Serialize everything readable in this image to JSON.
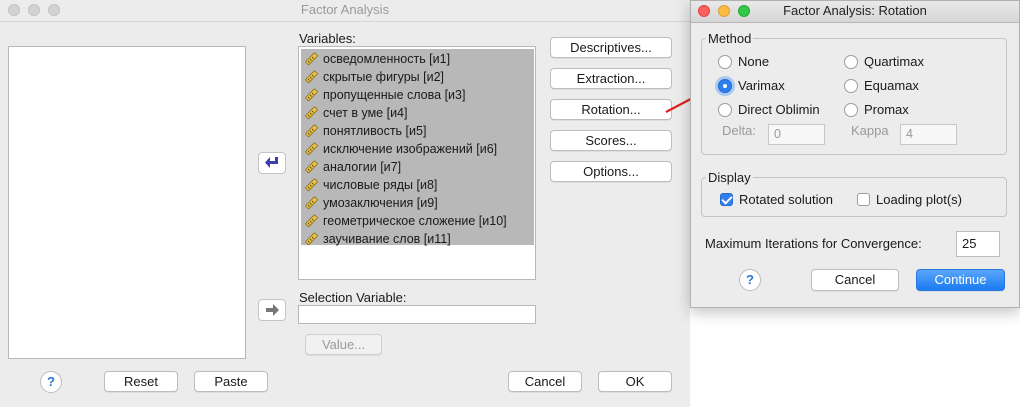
{
  "main_dialog": {
    "title": "Factor Analysis",
    "variables_label": "Variables:",
    "variables": [
      "осведомленность [и1]",
      "скрытые фигуры [и2]",
      "пропущенные слова [и3]",
      "счет в уме [и4]",
      "понятливость [и5]",
      "исключение изображений [и6]",
      "аналогии [и7]",
      "числовые ряды [и8]",
      "умозаключения [и9]",
      "геометрическое сложение [и10]",
      "заучивание слов [и11]"
    ],
    "selection_variable_label": "Selection Variable:",
    "value_button": "Value...",
    "buttons": {
      "descriptives": "Descriptives...",
      "extraction": "Extraction...",
      "rotation": "Rotation...",
      "scores": "Scores...",
      "options": "Options..."
    },
    "bottom": {
      "help": "?",
      "reset": "Reset",
      "paste": "Paste",
      "cancel": "Cancel",
      "ok": "OK"
    }
  },
  "rotation_dialog": {
    "title": "Factor Analysis: Rotation",
    "method_label": "Method",
    "methods": {
      "none": "None",
      "quartimax": "Quartimax",
      "varimax": "Varimax",
      "equamax": "Equamax",
      "direct_oblimin": "Direct Oblimin",
      "promax": "Promax"
    },
    "selected_method": "Varimax",
    "delta_label": "Delta:",
    "delta_value": "0",
    "kappa_label": "Kappa",
    "kappa_value": "4",
    "display_label": "Display",
    "rotated_solution_label": "Rotated solution",
    "rotated_solution_checked": true,
    "loading_plots_label": "Loading plot(s)",
    "loading_plots_checked": false,
    "max_iterations_label": "Maximum Iterations for Convergence:",
    "max_iterations_value": "25",
    "help": "?",
    "cancel": "Cancel",
    "continue": "Continue"
  },
  "colors": {
    "accent": "#1a7bf3",
    "selection": "#b8b8b8",
    "annotation_arrow": "#e0201b"
  },
  "icons": {
    "move_in": "arrow-left-icon",
    "move_selection": "arrow-right-icon",
    "variable": "ruler-icon"
  }
}
